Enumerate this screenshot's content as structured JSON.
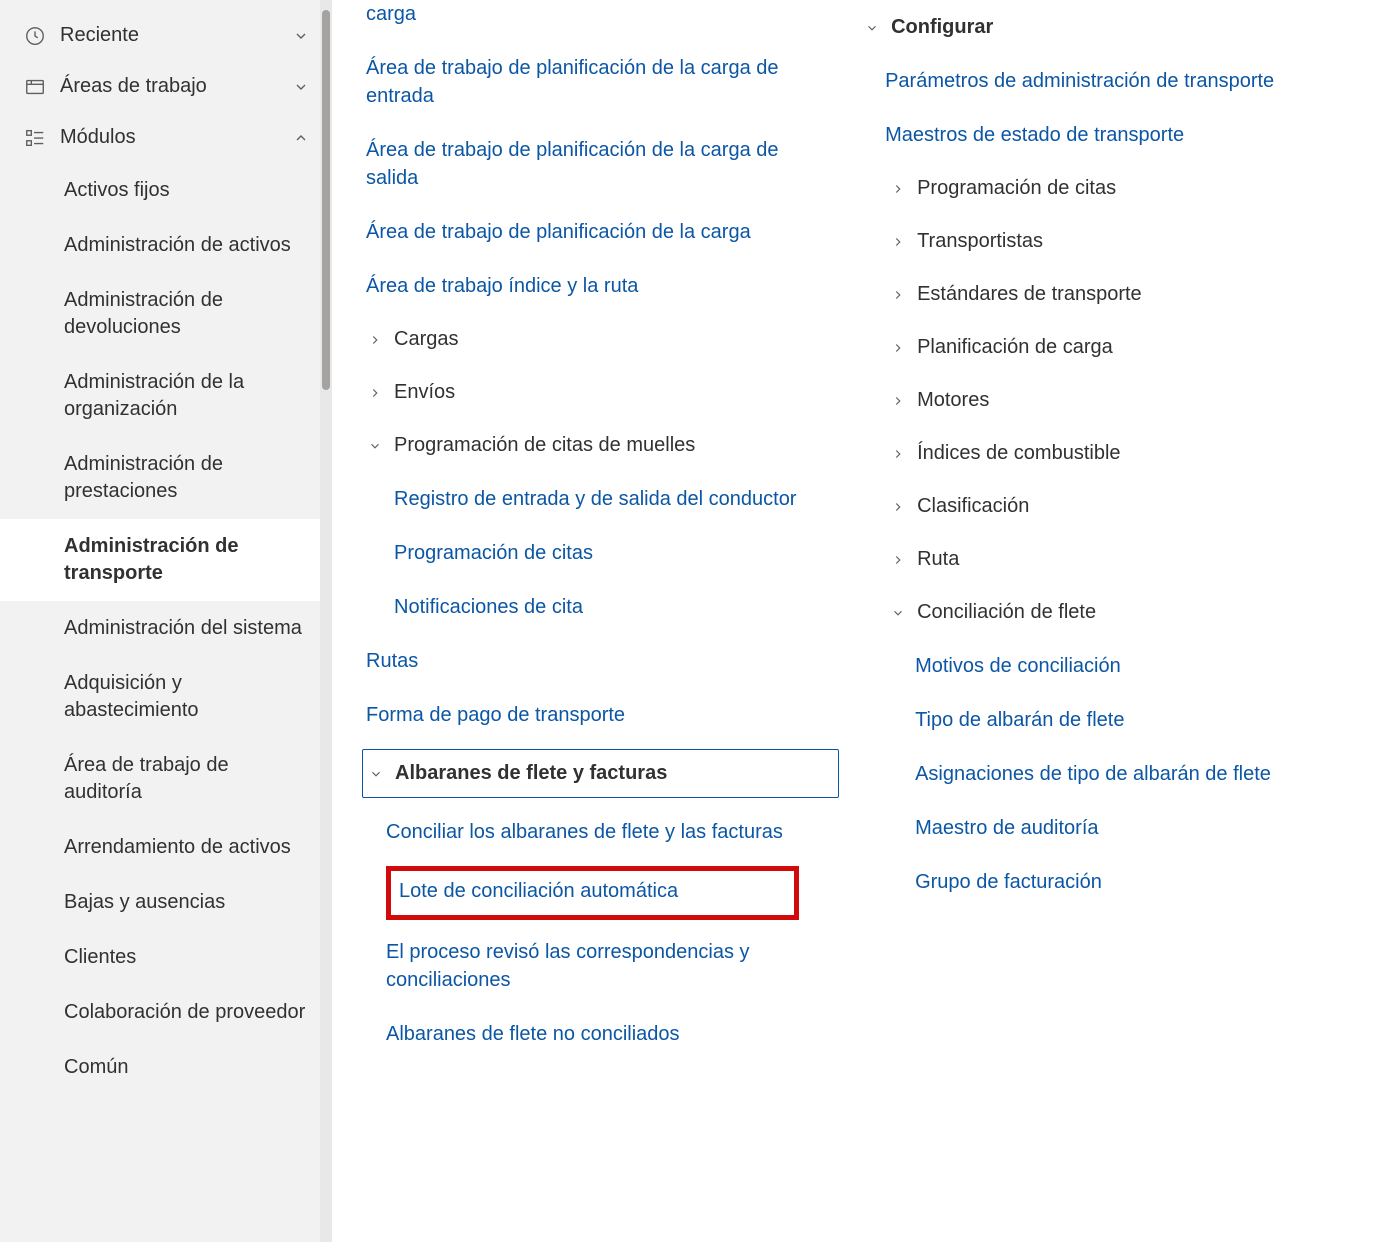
{
  "sidebar": {
    "reciente": "Reciente",
    "areas_trabajo": "Áreas de trabajo",
    "modulos": "Módulos",
    "modules": [
      "Activos fijos",
      "Administración de activos",
      "Administración de devoluciones",
      "Administración de la organización",
      "Administración de prestaciones",
      "Administración de transporte",
      "Administración del sistema",
      "Adquisición y abastecimiento",
      "Área de trabajo de auditoría",
      "Arrendamiento de activos",
      "Bajas y ausencias",
      "Clientes",
      "Colaboración de proveedor",
      "Común"
    ]
  },
  "col1": {
    "carga_top": "carga",
    "area_entrada": "Área de trabajo de planificación de la carga de entrada",
    "area_salida": "Área de trabajo de planificación de la carga de salida",
    "area_plan": "Área de trabajo de planificación de la carga",
    "area_indice": "Área de trabajo índice y la ruta",
    "cargas": "Cargas",
    "envios": "Envíos",
    "prog_citas_muelles": "Programación de citas de muelles",
    "registro_conductor": "Registro de entrada y de salida del conductor",
    "prog_citas": "Programación de citas",
    "notif_cita": "Notificaciones de cita",
    "rutas": "Rutas",
    "forma_pago": "Forma de pago de transporte",
    "albaranes_header": "Albaranes de flete y facturas",
    "conciliar_alb": "Conciliar los albaranes de flete y las facturas",
    "lote_auto": "Lote de conciliación automática",
    "proceso_rev": "El proceso revisó las correspondencias y conciliaciones",
    "alb_no_conc": "Albaranes de flete no conciliados"
  },
  "col2": {
    "configurar": "Configurar",
    "parametros": "Parámetros de administración de transporte",
    "maestros_estado": "Maestros de estado de transporte",
    "prog_citas": "Programación de citas",
    "transportistas": "Transportistas",
    "estandares": "Estándares de transporte",
    "plan_carga": "Planificación de carga",
    "motores": "Motores",
    "indices_comb": "Índices de combustible",
    "clasificacion": "Clasificación",
    "ruta": "Ruta",
    "conciliacion_flete": "Conciliación de flete",
    "motivos": "Motivos de conciliación",
    "tipo_alb": "Tipo de albarán de flete",
    "asignaciones": "Asignaciones de tipo de albarán de flete",
    "maestro_aud": "Maestro de auditoría",
    "grupo_fact": "Grupo de facturación"
  }
}
